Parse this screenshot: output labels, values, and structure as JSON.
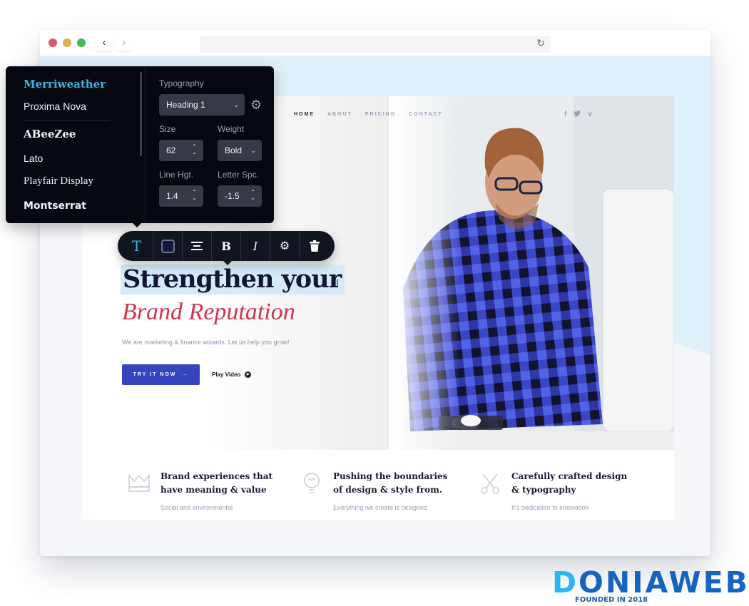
{
  "browser": {
    "window_controls": [
      "close",
      "minimize",
      "maximize"
    ],
    "back_icon": "‹",
    "forward_icon": "›",
    "reload_icon": "↻",
    "url": ""
  },
  "font_panel": {
    "fonts": [
      {
        "name": "Merriweather",
        "selected": true
      },
      {
        "name": "Proxima Nova",
        "selected": false
      },
      {
        "name": "ABeeZee",
        "selected": false
      },
      {
        "name": "Lato",
        "selected": false
      },
      {
        "name": "Playfair Display",
        "selected": false
      },
      {
        "name": "Montserrat",
        "selected": false
      }
    ],
    "typography_label": "Typography",
    "typography_value": "Heading 1",
    "size_label": "Size",
    "size_value": "62",
    "weight_label": "Weight",
    "weight_value": "Bold",
    "line_height_label": "Line Hgt.",
    "line_height_value": "1.4",
    "letter_spacing_label": "Letter Spc.",
    "letter_spacing_value": "-1.5",
    "chevron": "⌄",
    "spinner": "⌃⌄",
    "gear_icon": "⚙"
  },
  "toolbar": {
    "text_tool": "T",
    "color_swatch": "#121740",
    "align_icon": "≡",
    "bold": "B",
    "italic": "I",
    "settings_icon": "⚙",
    "delete_icon": "🗑"
  },
  "site": {
    "nav": [
      "HOME",
      "ABOUT",
      "PRICING",
      "CONTACT"
    ],
    "nav_active": "HOME",
    "social": [
      "f",
      "t",
      "v"
    ],
    "heading": "Strengthen your",
    "subheading": "Brand Reputation",
    "lead": "We are marketing & finance wizards. Let us help you grow!",
    "cta_label": "TRY IT NOW",
    "cta_arrow": "→",
    "play_label": "Play Video",
    "play_icon": "▶",
    "features": [
      {
        "icon": "crown-icon",
        "title": "Brand experiences that have meaning & value",
        "subtitle": "Social and environmental"
      },
      {
        "icon": "lightbulb-icon",
        "title": "Pushing the boundaries of design & style from.",
        "subtitle": "Everything we create is designed"
      },
      {
        "icon": "scissors-icon",
        "title": "Carefully crafted design & typography",
        "subtitle": "It's dedication to innovation"
      }
    ],
    "colors": {
      "accent": "#3644c0",
      "heading": "#121636",
      "subheading": "#d0344f",
      "selection": "#d3ebf7"
    }
  },
  "watermark": {
    "first": "D",
    "rest": "ONIAWEB",
    "tagline": "FOUNDED IN 2018"
  }
}
